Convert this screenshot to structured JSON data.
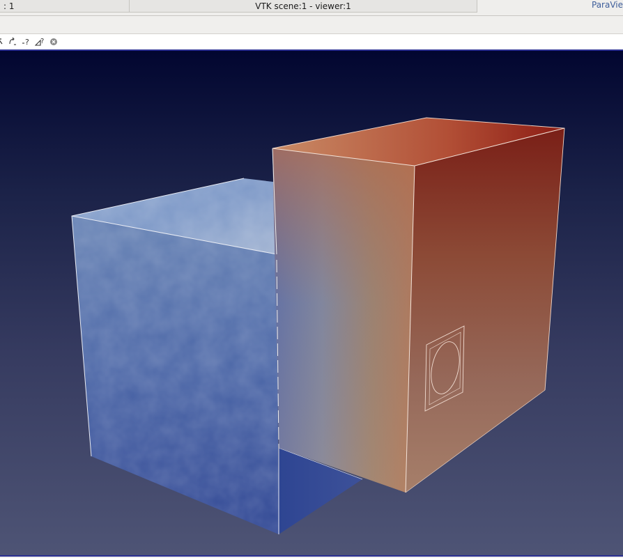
{
  "tabs": {
    "left_label": ": 1",
    "active_label": "VTK scene:1 - viewer:1"
  },
  "brand": {
    "label": "ParaVie"
  },
  "toolbar": {
    "items": [
      {
        "icon": "rotate-icon",
        "label": "↖"
      },
      {
        "icon": "arc-rotate-icon",
        "label": "↶"
      },
      {
        "icon": "query-icon",
        "label": "-?"
      },
      {
        "icon": "hover-query-icon",
        "label": "⊿?"
      },
      {
        "icon": "close-circle-icon",
        "label": "⊗"
      }
    ]
  },
  "scene": {
    "background_top": "#020630",
    "background_bottom": "#4e5475",
    "cold_color": "#2f4794",
    "hot_color": "#8a1c14",
    "edge_color": "#f2f2f2"
  }
}
